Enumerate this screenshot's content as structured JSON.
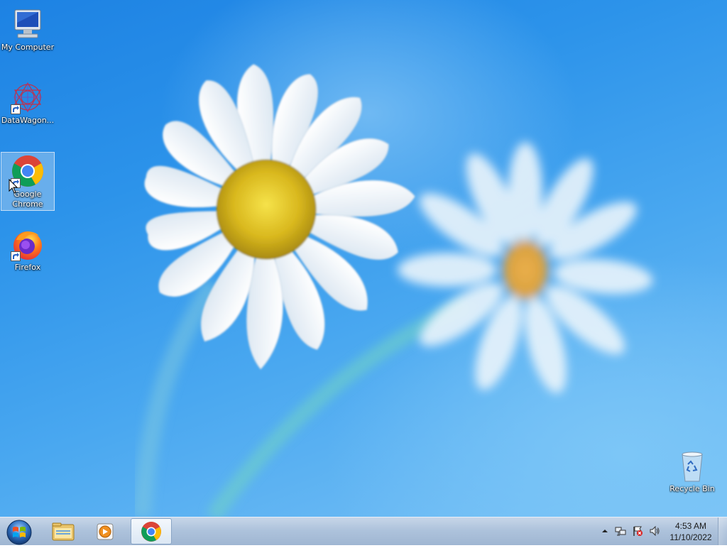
{
  "desktop": {
    "icons": [
      {
        "label": "My Computer",
        "icon": "computer-icon"
      },
      {
        "label": "DataWagon...",
        "icon": "datawagon-icon",
        "shortcut": true
      },
      {
        "label": "Google Chrome",
        "icon": "chrome-icon",
        "shortcut": true,
        "selected": true
      },
      {
        "label": "Firefox",
        "icon": "firefox-icon",
        "shortcut": true
      },
      {
        "label": "Recycle Bin",
        "icon": "recycle-bin-icon"
      }
    ]
  },
  "taskbar": {
    "start_icon": "windows-start-icon",
    "pinned": [
      {
        "icon": "file-explorer-icon"
      },
      {
        "icon": "media-player-icon"
      },
      {
        "icon": "chrome-icon",
        "active": true
      }
    ],
    "tray": {
      "icons": [
        "show-hidden-icons-arrow",
        "network-icon",
        "action-center-flag-icon",
        "volume-icon"
      ]
    },
    "clock": {
      "time": "4:53 AM",
      "date": "11/10/2022"
    }
  },
  "colors": {
    "taskbar": "#aec3dc",
    "wallpaper_blue": "#2c93ea"
  }
}
